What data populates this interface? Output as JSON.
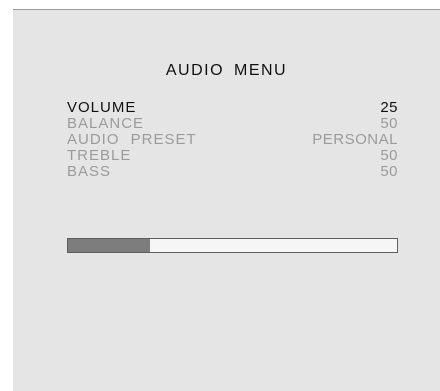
{
  "menu": {
    "title": "AUDIO MENU",
    "selected_index": 0,
    "items": [
      {
        "label": "VOLUME",
        "value": "25"
      },
      {
        "label": "BALANCE",
        "value": "50"
      },
      {
        "label": "AUDIO PRESET",
        "value": "PERSONAL"
      },
      {
        "label": "TREBLE",
        "value": "50"
      },
      {
        "label": "BASS",
        "value": "50"
      }
    ]
  },
  "level_bar": {
    "fraction": 0.25
  },
  "colors": {
    "panel_background": "#e5e5e5",
    "selected_text": "#111111",
    "dimmed_text": "#9b9b9b",
    "bar_fill": "#7d7d7d",
    "bar_border": "#5e5e5e"
  }
}
